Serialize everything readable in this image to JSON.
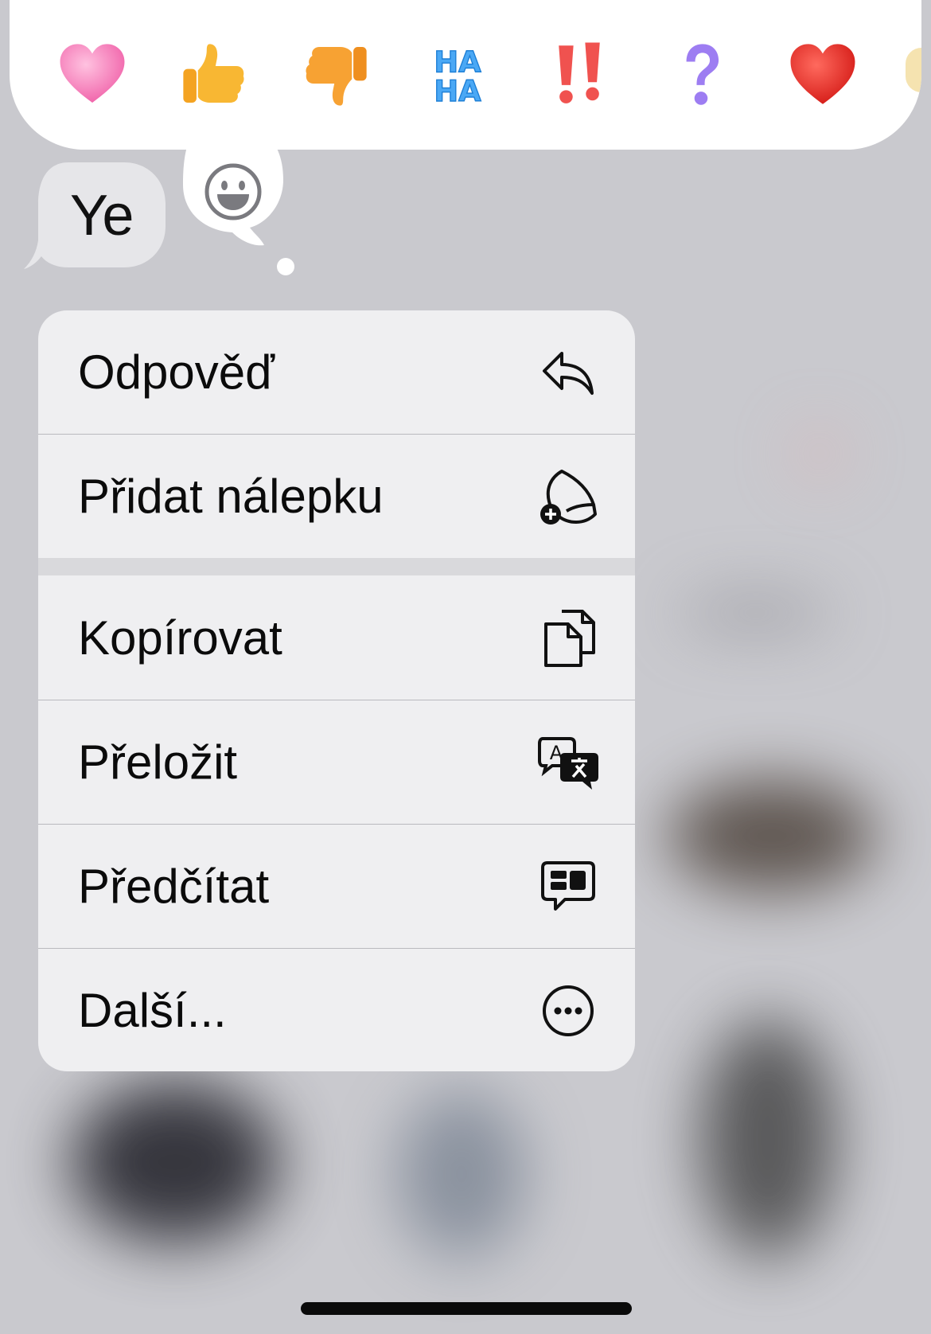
{
  "reactions": [
    {
      "name": "pink-heart",
      "color": "#f27bb7"
    },
    {
      "name": "thumbs-up",
      "color": "#f8b733"
    },
    {
      "name": "thumbs-down",
      "color": "#f7a233"
    },
    {
      "name": "haha",
      "top": "HA",
      "bottom": "HA",
      "color": "#4aa8f5"
    },
    {
      "name": "exclamation",
      "color": "#f0524f"
    },
    {
      "name": "question",
      "color": "#9d7df2"
    },
    {
      "name": "red-heart",
      "color": "#e3231d"
    }
  ],
  "message": {
    "text": "Ye"
  },
  "menu": {
    "items": [
      {
        "label": "Odpověď",
        "icon": "reply-icon"
      },
      {
        "label": "Přidat nálepku",
        "icon": "add-sticker-icon"
      },
      {
        "label": "Kopírovat",
        "icon": "copy-icon"
      },
      {
        "label": "Přeložit",
        "icon": "translate-icon"
      },
      {
        "label": "Předčítat",
        "icon": "speak-icon"
      },
      {
        "label": "Další...",
        "icon": "more-icon"
      }
    ]
  }
}
